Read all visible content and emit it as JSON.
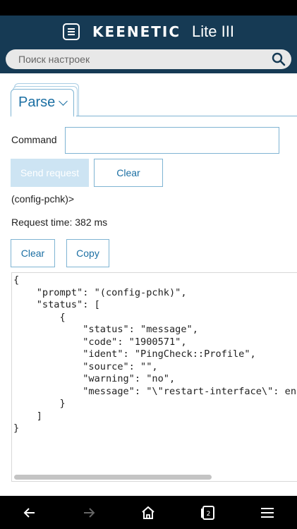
{
  "header": {
    "brand": "KEENETIC",
    "model": "Lite III",
    "search_placeholder": "Поиск настроек"
  },
  "tab": {
    "label": "Parse"
  },
  "form": {
    "command_label": "Command",
    "command_value": "",
    "send_label": "Send request",
    "clear_label": "Clear"
  },
  "result": {
    "prompt": "(config-pchk)>",
    "request_time": "Request time: 382 ms",
    "clear_label": "Clear",
    "copy_label": "Copy",
    "output_lines": [
      "{",
      "    \"prompt\": \"(config-pchk)\",",
      "    \"status\": [",
      "        {",
      "            \"status\": \"message\",",
      "            \"code\": \"1900571\",",
      "            \"ident\": \"PingCheck::Profile\",",
      "            \"source\": \"\",",
      "            \"warning\": \"no\",",
      "            \"message\": \"\\\"restart-interface\\\": enabled.\"",
      "        }",
      "    ]",
      "}"
    ]
  },
  "nav": {
    "tab_count": "2",
    "icons": [
      "back-arrow-icon",
      "forward-arrow-icon",
      "home-icon",
      "tabs-icon",
      "menu-icon"
    ]
  },
  "colors": {
    "header_bg": "#163a54",
    "accent": "#1b6fa3",
    "border": "#7fb4d3",
    "disabled_button": "#cde4f3"
  }
}
